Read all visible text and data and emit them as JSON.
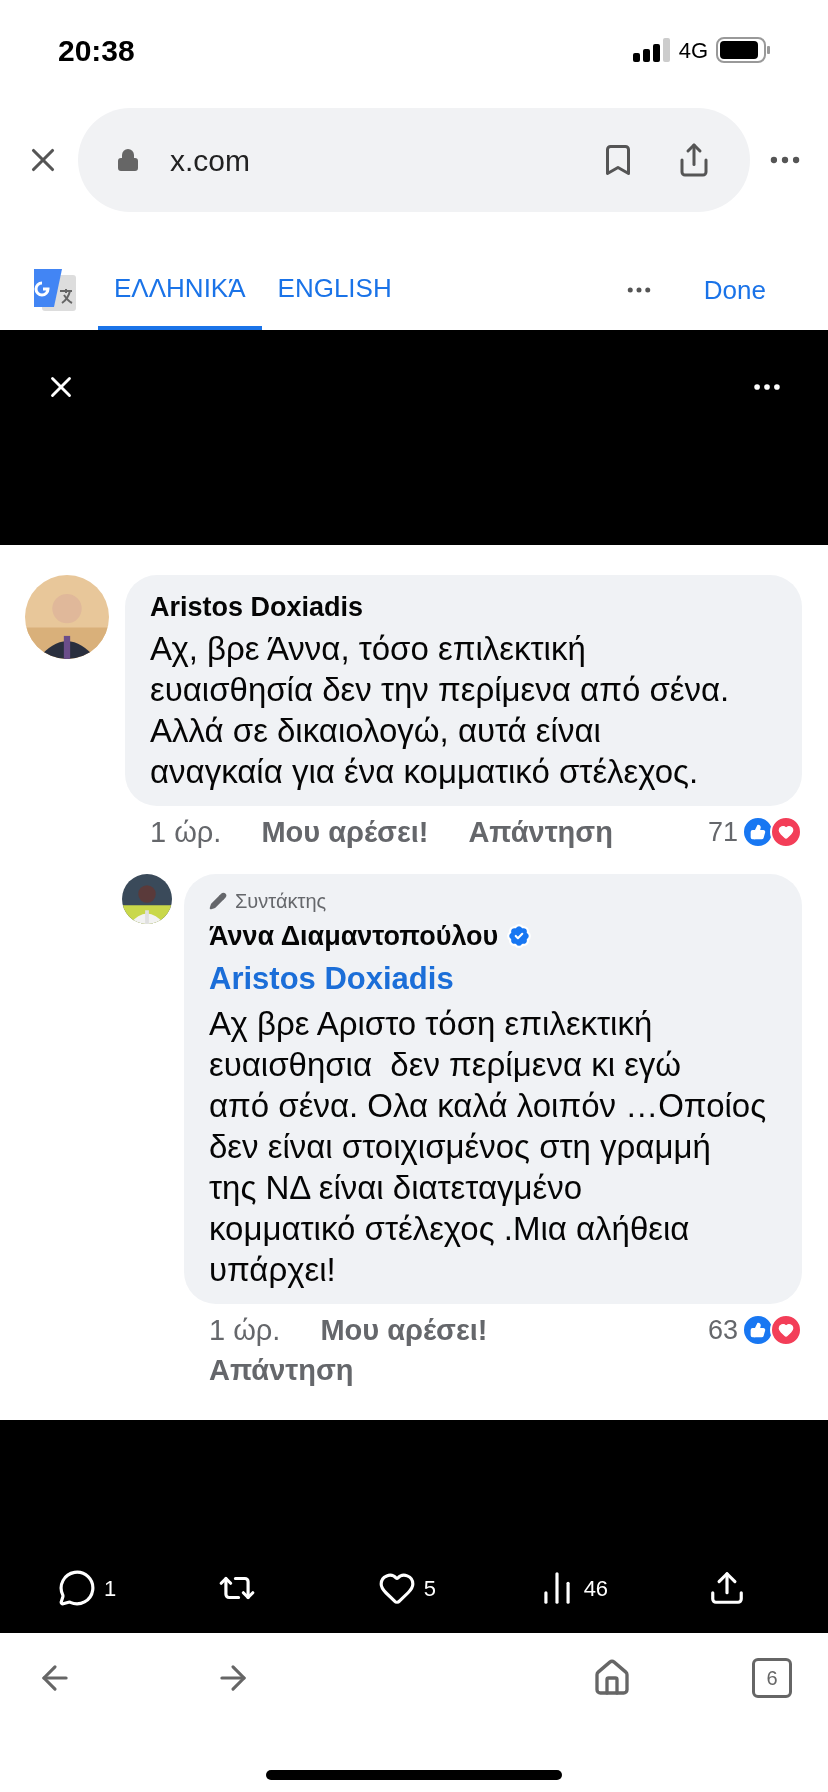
{
  "status_bar": {
    "time": "20:38",
    "network": "4G"
  },
  "browser": {
    "url": "x.com"
  },
  "translate_bar": {
    "tabs": [
      {
        "label": "ΕΛΛΗΝΙΚΆ",
        "selected": true
      },
      {
        "label": "ENGLISH",
        "selected": false
      }
    ],
    "done": "Done"
  },
  "comments": [
    {
      "author": "Aristos Doxiadis",
      "verified": false,
      "text": "Αχ, βρε Άννα, τόσο επιλεκτική\nευαισθησία δεν την περίμενα από σένα.\nΑλλά σε δικαιολογώ, αυτά είναι\nαναγκαία για ένα κομματικό στέλεχος.",
      "time": "1 ώρ.",
      "like": "Μου αρέσει!",
      "reply": "Απάντηση",
      "reactions": "71",
      "reply_level": false
    },
    {
      "author": "Άννα Διαμαντοπούλου",
      "badge": "Συντάκτης",
      "verified": true,
      "mention": "Aristos Doxiadis",
      "text": "Αχ βρε Αριστο τόση επιλεκτική\nευαισθησια  δεν περίμενα κι εγώ\nαπό σένα. Ολα καλά λοιπόν …Οποίος\nδεν είναι στοιχισμένος στη γραμμή\nτης ΝΔ είναι διατεταγμένο\nκομματικό στέλεχος .Μια αλήθεια\nυπάρχει!",
      "time": "1 ώρ.",
      "like": "Μου αρέσει!",
      "reply": "Απάντηση",
      "reactions": "63",
      "reply_level": true
    }
  ],
  "post_actions": [
    {
      "kind": "reply",
      "count": "1"
    },
    {
      "kind": "repost"
    },
    {
      "kind": "like",
      "count": "5"
    },
    {
      "kind": "views",
      "count": "46"
    },
    {
      "kind": "share"
    }
  ],
  "toolbar": {
    "tab_count": "6"
  }
}
